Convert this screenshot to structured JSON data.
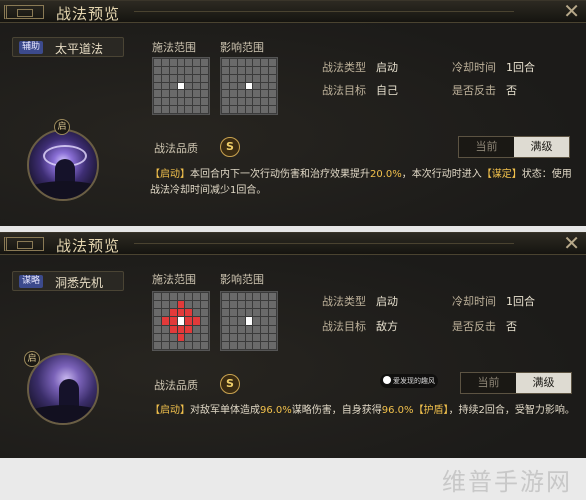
{
  "panels": [
    {
      "title": "战法预览",
      "close": "✕",
      "skill": {
        "tag": "辅助",
        "name": "太平道法",
        "level_glyph": "启"
      },
      "range_labels": {
        "cast": "施法范围",
        "effect": "影响范围"
      },
      "cast_grid_highlight": "center",
      "effect_grid_highlight": "center",
      "attrs": {
        "type_label": "战法类型",
        "type_value": "启动",
        "cooldown_label": "冷却时间",
        "cooldown_value": "1回合",
        "target_label": "战法目标",
        "target_value": "自己",
        "counter_label": "是否反击",
        "counter_value": "否"
      },
      "quality_label": "战法品质",
      "quality_value": "S",
      "toggle": {
        "off": "当前",
        "on": "满级"
      },
      "desc": {
        "kw1": "【启动】",
        "t1": "本回合内下一次行动伤害和治疗效果提升",
        "hl1": "20.0%",
        "t2": "，本次行动时进入",
        "kw2": "【谋定】",
        "t3": "状态：使用战法冷却时间减少1回合。"
      }
    },
    {
      "title": "战法预览",
      "close": "✕",
      "skill": {
        "tag": "谋略",
        "name": "洞悉先机",
        "level_glyph": "启"
      },
      "range_labels": {
        "cast": "施法范围",
        "effect": "影响范围"
      },
      "cast_grid_highlight": "cross",
      "effect_grid_highlight": "center",
      "attrs": {
        "type_label": "战法类型",
        "type_value": "启动",
        "cooldown_label": "冷却时间",
        "cooldown_value": "1回合",
        "target_label": "战法目标",
        "target_value": "敌方",
        "counter_label": "是否反击",
        "counter_value": "否"
      },
      "quality_label": "战法品质",
      "quality_value": "S",
      "toggle": {
        "off": "当前",
        "on": "满级"
      },
      "desc": {
        "kw1": "【启动】",
        "t1": "对敌军单体造成",
        "hl1": "96.0%",
        "t2": "谋略伤害，自身获得",
        "hl2": "96.0%",
        "kw2": "【护盾】",
        "t3": "，持续2回合，受智力影响。"
      }
    }
  ],
  "watermark": "爱发现的趣风",
  "brand": "维普手游网"
}
